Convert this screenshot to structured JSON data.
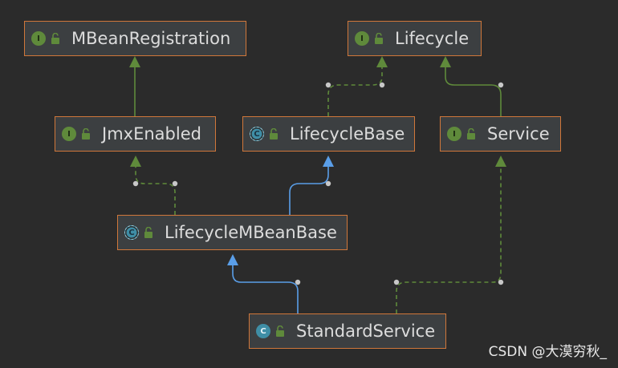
{
  "nodes": [
    {
      "id": "MBeanRegistration",
      "label": "MBeanRegistration",
      "kind": "interface",
      "badge": "I"
    },
    {
      "id": "Lifecycle",
      "label": "Lifecycle",
      "kind": "interface",
      "badge": "I"
    },
    {
      "id": "JmxEnabled",
      "label": "JmxEnabled",
      "kind": "interface",
      "badge": "I"
    },
    {
      "id": "LifecycleBase",
      "label": "LifecycleBase",
      "kind": "abstract-class",
      "badge": "C"
    },
    {
      "id": "Service",
      "label": "Service",
      "kind": "interface",
      "badge": "I"
    },
    {
      "id": "LifecycleMBeanBase",
      "label": "LifecycleMBeanBase",
      "kind": "abstract-class",
      "badge": "C"
    },
    {
      "id": "StandardService",
      "label": "StandardService",
      "kind": "class",
      "badge": "C"
    }
  ],
  "edges": [
    {
      "from": "JmxEnabled",
      "to": "MBeanRegistration",
      "type": "interface-extends"
    },
    {
      "from": "LifecycleBase",
      "to": "Lifecycle",
      "type": "implements"
    },
    {
      "from": "Service",
      "to": "Lifecycle",
      "type": "interface-extends"
    },
    {
      "from": "LifecycleMBeanBase",
      "to": "JmxEnabled",
      "type": "implements"
    },
    {
      "from": "LifecycleMBeanBase",
      "to": "LifecycleBase",
      "type": "extends"
    },
    {
      "from": "StandardService",
      "to": "LifecycleMBeanBase",
      "type": "extends"
    },
    {
      "from": "StandardService",
      "to": "Service",
      "type": "implements"
    }
  ],
  "colors": {
    "background": "#2b2b2b",
    "node_fill": "#3c3f41",
    "node_border": "#d0773a",
    "text": "#dcdcdc",
    "interface_edge": "#5f8a3b",
    "extends_edge": "#5a9ee8",
    "lock": "#5f8a3b"
  },
  "icons": {
    "visibility": "open-lock-icon"
  },
  "watermark": "CSDN @大漠穷秋_"
}
